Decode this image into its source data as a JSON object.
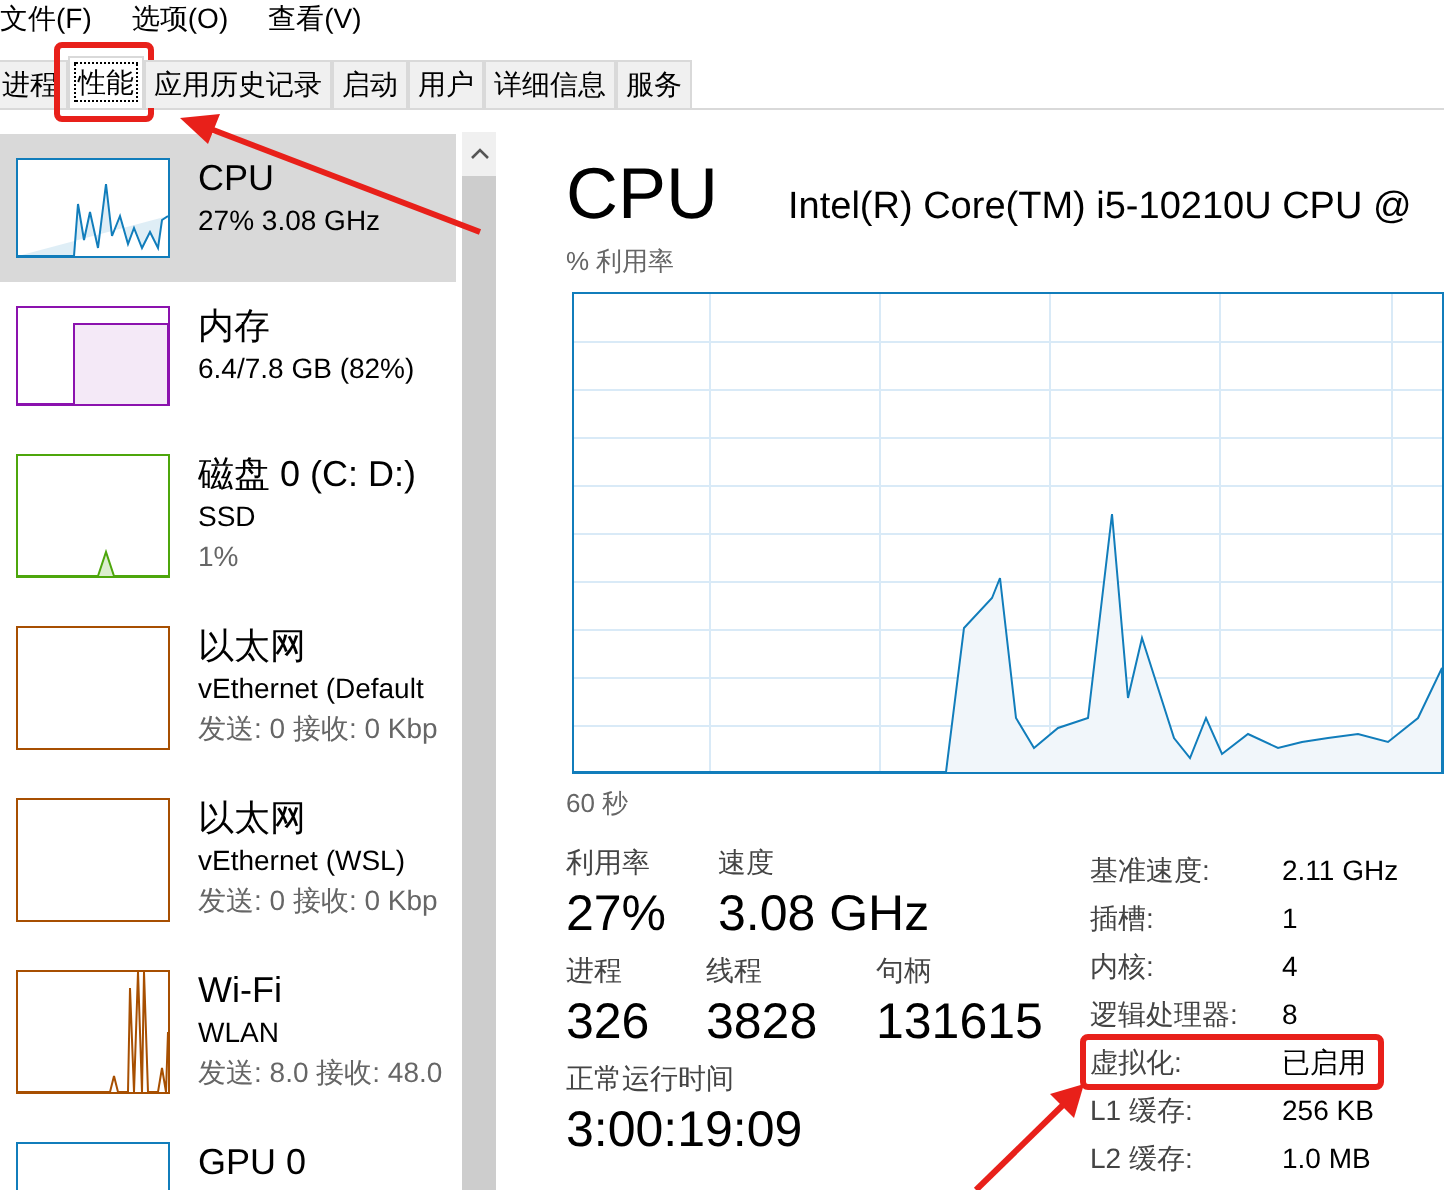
{
  "menu": [
    "文件(F)",
    "选项(O)",
    "查看(V)"
  ],
  "tabs": [
    {
      "label": "进程",
      "selected": false,
      "annotated": false
    },
    {
      "label": "性能",
      "selected": true,
      "annotated": true
    },
    {
      "label": "应用历史记录",
      "selected": false,
      "annotated": false
    },
    {
      "label": "启动",
      "selected": false,
      "annotated": false
    },
    {
      "label": "用户",
      "selected": false,
      "annotated": false
    },
    {
      "label": "详细信息",
      "selected": false,
      "annotated": false
    },
    {
      "label": "服务",
      "selected": false,
      "annotated": false
    }
  ],
  "sidebar": {
    "items": [
      {
        "name": "CPU",
        "lines": [
          "27% 3.08 GHz"
        ],
        "color": "#117dbb",
        "selected": true,
        "kind": "wave"
      },
      {
        "name": "内存",
        "lines": [
          "6.4/7.8 GB (82%)"
        ],
        "color": "#8b12ae",
        "selected": false,
        "kind": "block"
      },
      {
        "name": "磁盘 0 (C: D:)",
        "lines": [
          "SSD",
          "1%"
        ],
        "color": "#4da60c",
        "selected": false,
        "kind": "blip"
      },
      {
        "name": "以太网",
        "lines": [
          "vEthernet (Default",
          "发送: 0 接收: 0 Kbp"
        ],
        "color": "#a74f01",
        "selected": false,
        "kind": "flat"
      },
      {
        "name": "以太网",
        "lines": [
          "vEthernet (WSL)",
          "发送: 0 接收: 0 Kbp"
        ],
        "color": "#a74f01",
        "selected": false,
        "kind": "flat"
      },
      {
        "name": "Wi-Fi",
        "lines": [
          "WLAN",
          "发送: 8.0 接收: 48.0"
        ],
        "color": "#a74f01",
        "selected": false,
        "kind": "spikes"
      },
      {
        "name": "GPU 0",
        "color": "#117dbb",
        "selected": false,
        "kind": "flat"
      }
    ]
  },
  "detail": {
    "title": "CPU",
    "model": "Intel(R) Core(TM) i5-10210U CPU @",
    "chart_label": "% 利用率",
    "time_label": "60 秒",
    "stats": [
      [
        {
          "label": "利用率",
          "value": "27%"
        },
        {
          "label": "速度",
          "value": "3.08 GHz"
        }
      ],
      [
        {
          "label": "进程",
          "value": "326"
        },
        {
          "label": "线程",
          "value": "3828"
        },
        {
          "label": "句柄",
          "value": "131615"
        }
      ],
      [
        {
          "label": "正常运行时间",
          "value": "3:00:19:09"
        }
      ]
    ],
    "specs": [
      {
        "label": "基准速度:",
        "value": "2.11 GHz",
        "annotated": false
      },
      {
        "label": "插槽:",
        "value": "1",
        "annotated": false
      },
      {
        "label": "内核:",
        "value": "4",
        "annotated": false
      },
      {
        "label": "逻辑处理器:",
        "value": "8",
        "annotated": false
      },
      {
        "label": "虚拟化:",
        "value": "已启用",
        "annotated": true
      },
      {
        "label": "L1 缓存:",
        "value": "256 KB",
        "annotated": false
      },
      {
        "label": "L2 缓存:",
        "value": "1.0 MB",
        "annotated": false
      }
    ]
  }
}
